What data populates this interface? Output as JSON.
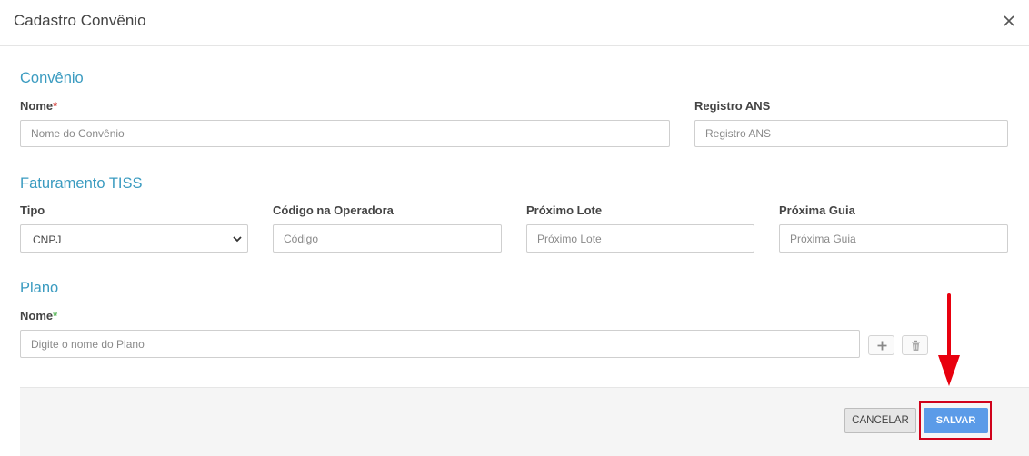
{
  "modal": {
    "title": "Cadastro Convênio"
  },
  "icons": {
    "close": "close-icon",
    "add": "plus-icon",
    "delete": "trash-icon",
    "chevron": "chevron-down-icon"
  },
  "convenio": {
    "section_title": "Convênio",
    "nome": {
      "label": "Nome",
      "required_mark": "*",
      "placeholder": "Nome do Convênio"
    },
    "registro_ans": {
      "label": "Registro ANS",
      "placeholder": "Registro ANS"
    }
  },
  "faturamento": {
    "section_title": "Faturamento TISS",
    "tipo": {
      "label": "Tipo",
      "value": "CNPJ"
    },
    "codigo": {
      "label": "Código na Operadora",
      "placeholder": "Código"
    },
    "proximo_lote": {
      "label": "Próximo Lote",
      "placeholder": "Próximo Lote"
    },
    "proxima_guia": {
      "label": "Próxima Guia",
      "placeholder": "Próxima Guia"
    }
  },
  "plano": {
    "section_title": "Plano",
    "nome": {
      "label": "Nome",
      "required_mark": "*",
      "placeholder": "Digite o nome do Plano"
    }
  },
  "footer": {
    "cancel_label": "CANCELAR",
    "save_label": "SALVAR"
  },
  "colors": {
    "accent": "#3a9bc0",
    "save_button": "#5b9be8",
    "highlight": "#d0021b",
    "required_red": "#d9534f",
    "required_green": "#5cb85c"
  }
}
